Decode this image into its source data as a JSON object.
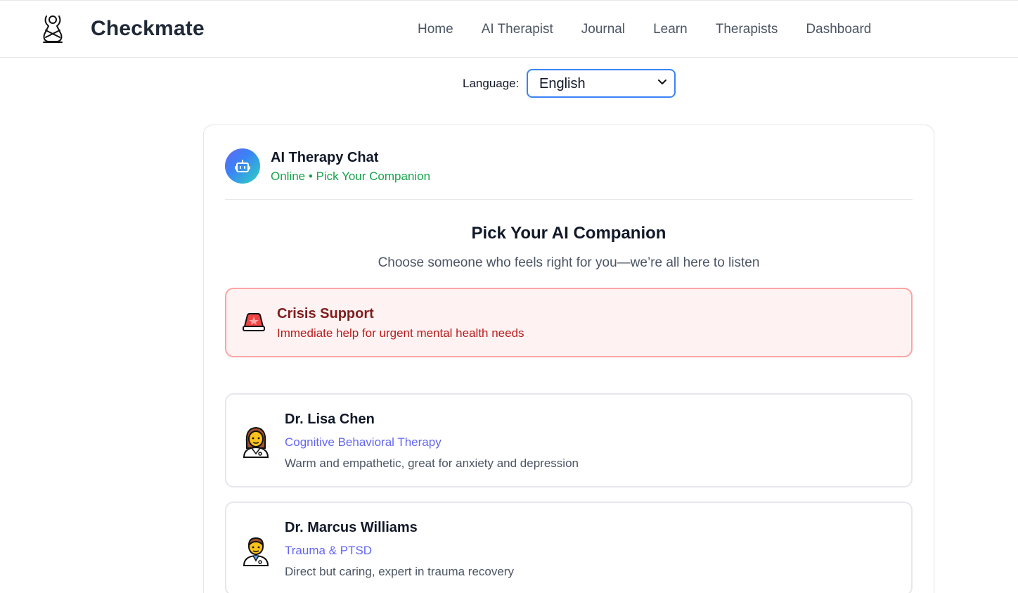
{
  "header": {
    "brand": "Checkmate",
    "nav": [
      "Home",
      "AI Therapist",
      "Journal",
      "Learn",
      "Therapists",
      "Dashboard"
    ]
  },
  "language": {
    "label": "Language:",
    "selected": "English"
  },
  "chat": {
    "title": "AI Therapy Chat",
    "status": "Online • Pick Your Companion",
    "avatar_icon": "robot-icon"
  },
  "picker": {
    "title": "Pick Your AI Companion",
    "subtitle": "Choose someone who feels right for you—we’re all here to listen"
  },
  "crisis": {
    "icon": "siren-icon",
    "title": "Crisis Support",
    "description": "Immediate help for urgent mental health needs"
  },
  "companions": [
    {
      "icon": "woman-health-worker-icon",
      "name": "Dr. Lisa Chen",
      "specialty": "Cognitive Behavioral Therapy",
      "description": "Warm and empathetic, great for anxiety and depression"
    },
    {
      "icon": "man-health-worker-icon",
      "name": "Dr. Marcus Williams",
      "specialty": "Trauma & PTSD",
      "description": "Direct but caring, expert in trauma recovery"
    }
  ],
  "colors": {
    "accent": "#3b82f6",
    "online": "#16a34a",
    "crisis_title": "#7f1d1d",
    "crisis_text": "#b91c1c",
    "specialty": "#6366f1"
  }
}
